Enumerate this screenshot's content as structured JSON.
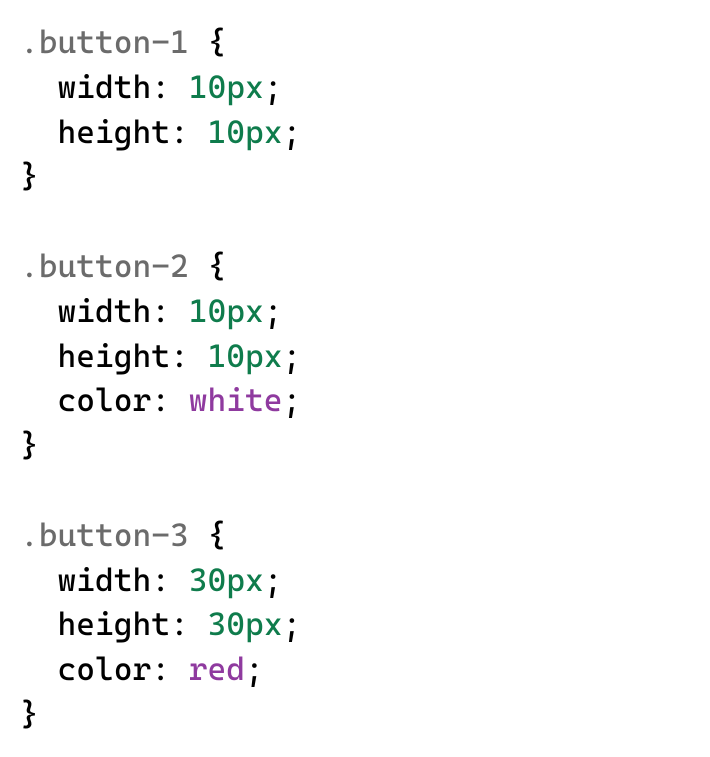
{
  "rules": [
    {
      "selector": ".button-1",
      "declarations": [
        {
          "property": "width",
          "value": "10px",
          "value_type": "number"
        },
        {
          "property": "height",
          "value": "10px",
          "value_type": "number"
        }
      ]
    },
    {
      "selector": ".button-2",
      "declarations": [
        {
          "property": "width",
          "value": "10px",
          "value_type": "number"
        },
        {
          "property": "height",
          "value": "10px",
          "value_type": "number"
        },
        {
          "property": "color",
          "value": "white",
          "value_type": "color"
        }
      ]
    },
    {
      "selector": ".button-3",
      "declarations": [
        {
          "property": "width",
          "value": "30px",
          "value_type": "number"
        },
        {
          "property": "height",
          "value": "30px",
          "value_type": "number"
        },
        {
          "property": "color",
          "value": "red",
          "value_type": "color"
        }
      ]
    }
  ],
  "indent": "  ",
  "open_brace": " {",
  "close_brace": "}",
  "colon": ": ",
  "semicolon": ";"
}
